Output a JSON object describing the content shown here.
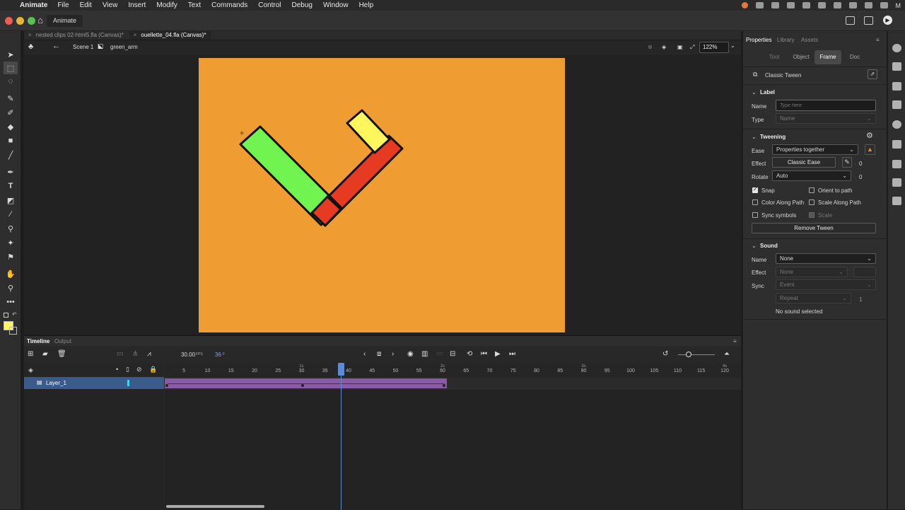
{
  "menubar": {
    "app_name": "Animate",
    "items": [
      "File",
      "Edit",
      "View",
      "Insert",
      "Modify",
      "Text",
      "Commands",
      "Control",
      "Debug",
      "Window",
      "Help"
    ],
    "user_initial": "M"
  },
  "appbar": {
    "title": "Animate"
  },
  "doc_tabs": [
    {
      "label": "nested clips 02-html5.fla (Canvas)*",
      "active": false
    },
    {
      "label": "ouellette_04.fla (Canvas)*",
      "active": true
    }
  ],
  "editbar": {
    "scene": "Scene 1",
    "symbol": "green_arm",
    "zoom": "122%"
  },
  "stage": {
    "background": "#ef9c33",
    "shapes": {
      "green_arm": "#72f450",
      "red_arm": "#e63a23",
      "yellow_hand": "#fff55c"
    }
  },
  "timeline": {
    "tabs": {
      "timeline": "Timeline",
      "output": "Output"
    },
    "fps": "30.00",
    "fps_unit": "FPS",
    "current_frame": "36",
    "frame_unit": "F",
    "layer_name": "Layer_1",
    "ruler_ticks": [
      "5",
      "10",
      "15",
      "20",
      "25",
      "30",
      "35",
      "40",
      "45",
      "50",
      "55",
      "60",
      "65",
      "70",
      "75",
      "80",
      "85",
      "90",
      "95",
      "100",
      "105",
      "110",
      "115",
      "120"
    ],
    "seconds_marks": [
      "1s",
      "2s",
      "3s",
      "4s"
    ],
    "tween_color": "#8a5aa8"
  },
  "properties": {
    "tabs": [
      "Properties",
      "Library",
      "Assets"
    ],
    "subtabs": [
      "Tool",
      "Object",
      "Frame",
      "Doc"
    ],
    "header": "Classic Tween",
    "label": {
      "title": "Label",
      "name_label": "Name",
      "name_placeholder": "Type here",
      "type_label": "Type",
      "type_value": "Name"
    },
    "tweening": {
      "title": "Tweening",
      "ease_label": "Ease",
      "ease_value": "Properties together",
      "effect_label": "Effect",
      "effect_button": "Classic Ease",
      "effect_value": "0",
      "rotate_label": "Rotate",
      "rotate_value": "Auto",
      "rotate_count": "0",
      "snap": "Snap",
      "orient_to_path": "Orient to path",
      "color_along_path": "Color Along Path",
      "scale_along_path": "Scale Along Path",
      "sync_symbols": "Sync symbols",
      "scale": "Scale",
      "remove_button": "Remove Tween"
    },
    "sound": {
      "title": "Sound",
      "name_label": "Name",
      "name_value": "None",
      "effect_label": "Effect",
      "effect_value": "None",
      "sync_label": "Sync",
      "sync_value": "Event",
      "repeat_value": "Repeat",
      "repeat_count": "1",
      "status": "No sound selected"
    }
  },
  "colors": {
    "fill_swatch": "#fff55c",
    "accent_blue": "#5d8bd4",
    "layer_selected": "#3b5b8c"
  }
}
